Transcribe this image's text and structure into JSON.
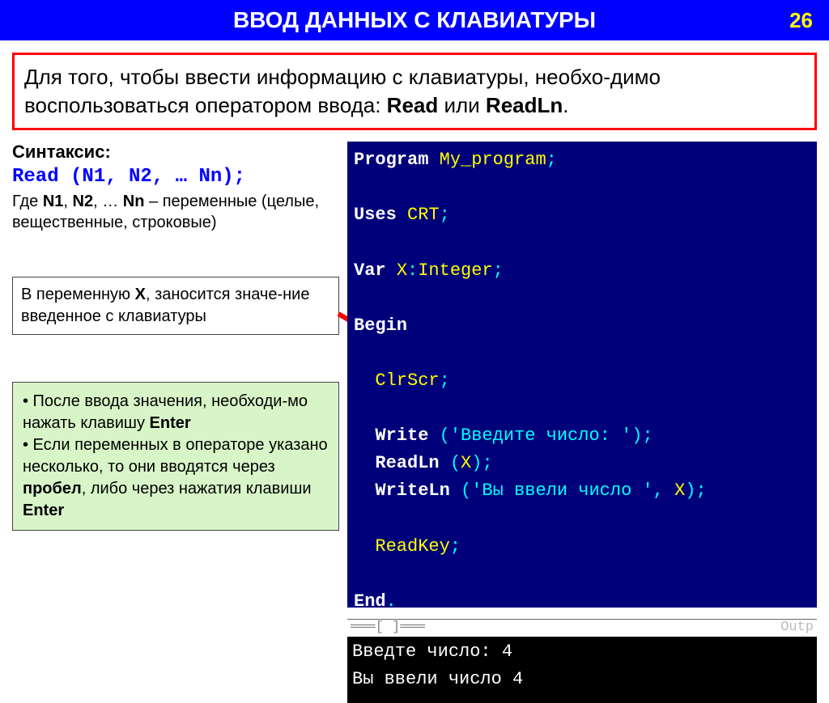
{
  "header": {
    "title": "ВВОД ДАННЫХ С КЛАВИАТУРЫ",
    "page": "26"
  },
  "intro": {
    "pre": "Для того, чтобы ввести информацию с клавиатуры, необхо-димо воспользоваться оператором ввода: ",
    "read": "Read",
    "or": " или ",
    "readln": "ReadLn",
    "dot": "."
  },
  "syntax": {
    "label": "Синтаксис",
    "code": "Read (N1, N2, … Nn);",
    "where_pre": "Где ",
    "n1": "N1",
    "c1": ", ",
    "n2": "N2",
    "c2": ", … ",
    "nn": "Nn",
    "where_post": " – переменные (целые, вещественные, строковые)"
  },
  "var_note": {
    "pre": "В переменную ",
    "x": "X",
    "post": ", заносится значе-ние введенное с клавиатуры"
  },
  "notes": {
    "l1a": "• После ввода значения, необходи-мо нажать клавишу ",
    "enter1": "Enter",
    "l2a": "• Если переменных в операторе указано несколько, то они вводятся через ",
    "space": "пробел",
    "l2b": ", либо через нажатия клавиши ",
    "enter2": "Enter"
  },
  "code": {
    "kw_program": "Program ",
    "id_prog": "My_program",
    "sc": ";",
    "kw_uses": "Uses ",
    "id_crt": "CRT",
    "kw_var": "Var ",
    "id_x": "X",
    "colon": ":",
    "id_int": "Integer",
    "kw_begin": "Begin",
    "id_clrscr": "ClrScr",
    "kw_write": "Write ",
    "lp": "(",
    "str1": "'Введите число: '",
    "rp": ")",
    "kw_readln": "ReadLn ",
    "x2": "X",
    "kw_writeln": "WriteLn ",
    "str2": "'Вы ввели число '",
    "cm": ", ",
    "x3": "X",
    "id_readkey": "ReadKey",
    "kw_end": "End",
    "dot": "."
  },
  "ide_bar": {
    "left": "═══[ ]═══",
    "right": "Outp"
  },
  "output": {
    "l1": "Введте число: 4",
    "l2": "Вы ввели число 4"
  }
}
